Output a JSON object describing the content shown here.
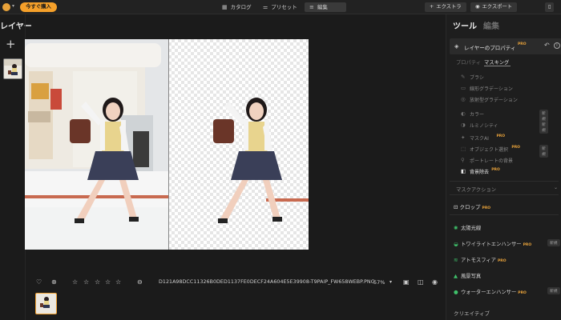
{
  "topbar": {
    "buy_label": "今すぐ購入",
    "tabs": [
      {
        "icon": "catalog-icon",
        "label": "カタログ"
      },
      {
        "icon": "preset-icon",
        "label": "プリセット"
      },
      {
        "icon": "edit-icon",
        "label": "編集"
      }
    ],
    "extras_label": "エクストラ",
    "export_label": "エクスポート"
  },
  "left": {
    "title": "レイヤー",
    "add_symbol": "+"
  },
  "bottom": {
    "filename": "D121A98DCC11326B0DED1137FE0DECF24A604E5E39908-T9PAIP_FW658WEBP.PNG",
    "zoom": "57%",
    "rating_stars": 5,
    "rating_filled": 0
  },
  "right": {
    "tools_title": "ツール",
    "edit_title": "編集",
    "layer_props": "レイヤーのプロパティ",
    "pro_badge": "PRO",
    "subtabs": {
      "properties": "プロパティ",
      "masking": "マスキング"
    },
    "mask_tools": [
      {
        "icon": "brush-icon",
        "label": "ブラシ",
        "badge": "",
        "pro": false,
        "bright": false
      },
      {
        "icon": "linear-gradient-icon",
        "label": "線形グラデーション",
        "badge": "",
        "pro": false,
        "bright": false
      },
      {
        "icon": "radial-gradient-icon",
        "label": "放射型グラデーション",
        "badge": "",
        "pro": false,
        "bright": false
      },
      {
        "icon": "color-icon",
        "label": "カラー",
        "badge": "新規",
        "pro": false,
        "bright": false
      },
      {
        "icon": "luminosity-icon",
        "label": "ルミノシティ",
        "badge": "新規",
        "pro": false,
        "bright": false
      },
      {
        "icon": "mask-ai-icon",
        "label": "マスクAI",
        "badge": "",
        "pro": true,
        "bright": false
      },
      {
        "icon": "object-select-icon",
        "label": "オブジェクト選択",
        "badge": "新規",
        "pro": true,
        "bright": false
      },
      {
        "icon": "portrait-bg-icon",
        "label": "ポートレートの背景",
        "badge": "",
        "pro": false,
        "bright": false
      },
      {
        "icon": "bg-remove-icon",
        "label": "背景除去",
        "badge": "",
        "pro": true,
        "bright": true
      }
    ],
    "mask_action": "マスクアクション",
    "crop_label": "クロップ",
    "tool_groups": [
      {
        "icon": "sun-icon",
        "label": "太陽光線",
        "badge": "",
        "pro": false
      },
      {
        "icon": "twilight-icon",
        "label": "トワイライトエンハンサー",
        "badge": "新規",
        "pro": true
      },
      {
        "icon": "atmosphere-icon",
        "label": "アトモスフィア",
        "badge": "",
        "pro": true
      },
      {
        "icon": "landscape-icon",
        "label": "風景写真",
        "badge": "",
        "pro": false
      },
      {
        "icon": "water-icon",
        "label": "ウォーターエンハンサー",
        "badge": "新規",
        "pro": true
      }
    ],
    "creative": "クリエイティブ"
  },
  "colors": {
    "accent": "#f5a02a",
    "green_icon": "#3fc06a",
    "panel_bg": "#1e1e1e"
  }
}
